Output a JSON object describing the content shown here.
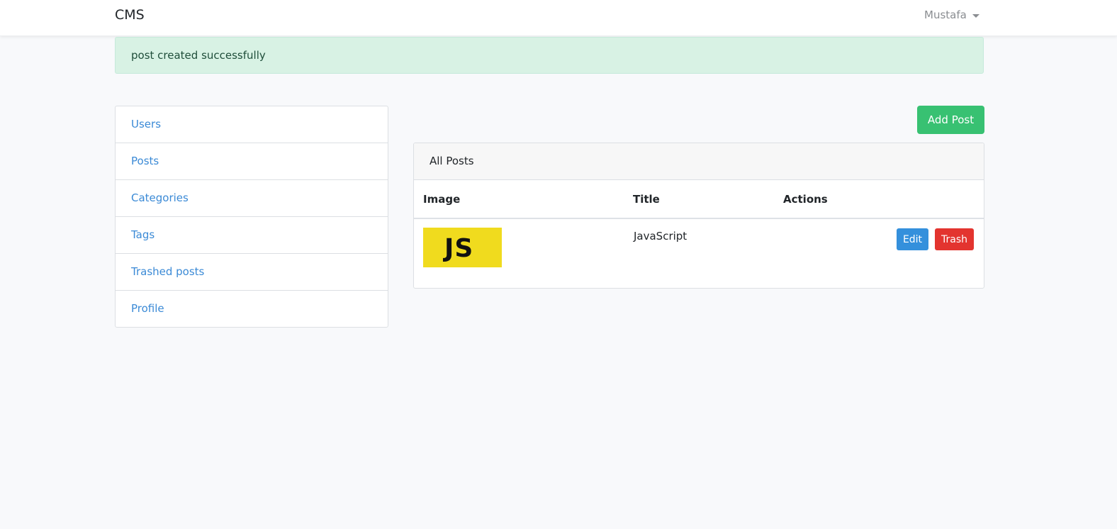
{
  "navbar": {
    "brand": "CMS",
    "user_name": "Mustafa"
  },
  "alert": {
    "message": "post created successfully",
    "color": "#d8f2e4"
  },
  "sidebar": {
    "items": [
      {
        "label": "Users"
      },
      {
        "label": "Posts"
      },
      {
        "label": "Categories"
      },
      {
        "label": "Tags"
      },
      {
        "label": "Trashed posts"
      },
      {
        "label": "Profile"
      }
    ]
  },
  "toolbar": {
    "add_post_label": "Add Post"
  },
  "posts_card": {
    "header": "All Posts",
    "columns": [
      "Image",
      "Title",
      "Actions"
    ],
    "rows": [
      {
        "image_text": "JS",
        "title": "JavaScript",
        "edit_label": "Edit",
        "trash_label": "Trash"
      }
    ]
  },
  "colors": {
    "link": "#3b8ad6",
    "success": "#38c172",
    "primary": "#3490dc",
    "danger": "#e3342f",
    "js_yellow": "#f0db1e"
  }
}
